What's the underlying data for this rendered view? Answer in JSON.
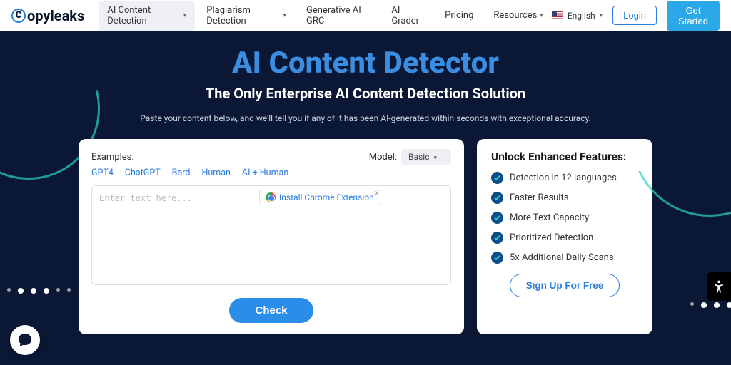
{
  "logo": "opyleaks",
  "nav": {
    "items": [
      {
        "label": "AI Content Detection",
        "dropdown": true,
        "active": true
      },
      {
        "label": "Plagiarism Detection",
        "dropdown": true,
        "active": false
      },
      {
        "label": "Generative AI GRC",
        "dropdown": false,
        "active": false
      },
      {
        "label": "AI Grader",
        "dropdown": false,
        "active": false
      },
      {
        "label": "Pricing",
        "dropdown": false,
        "active": false
      },
      {
        "label": "Resources",
        "dropdown": true,
        "active": false
      }
    ]
  },
  "lang": {
    "label": "English"
  },
  "auth": {
    "login": "Login",
    "get_started": "Get Started"
  },
  "hero": {
    "title": "AI Content Detector",
    "subtitle": "The Only Enterprise AI Content Detection Solution",
    "tagline": "Paste your content below, and we'll tell you if any of it has been AI-generated within seconds with exceptional accuracy."
  },
  "input_panel": {
    "examples_label": "Examples:",
    "examples": [
      "GPT4",
      "ChatGPT",
      "Bard",
      "Human",
      "AI + Human"
    ],
    "model_label": "Model:",
    "model_selected": "Basic",
    "placeholder": "Enter text here...",
    "chrome_ext": "Install Chrome Extension",
    "check_label": "Check"
  },
  "features_panel": {
    "title": "Unlock Enhanced Features:",
    "items": [
      "Detection in 12 languages",
      "Faster Results",
      "More Text Capacity",
      "Prioritized Detection",
      "5x Additional Daily Scans"
    ],
    "signup": "Sign Up For Free"
  }
}
